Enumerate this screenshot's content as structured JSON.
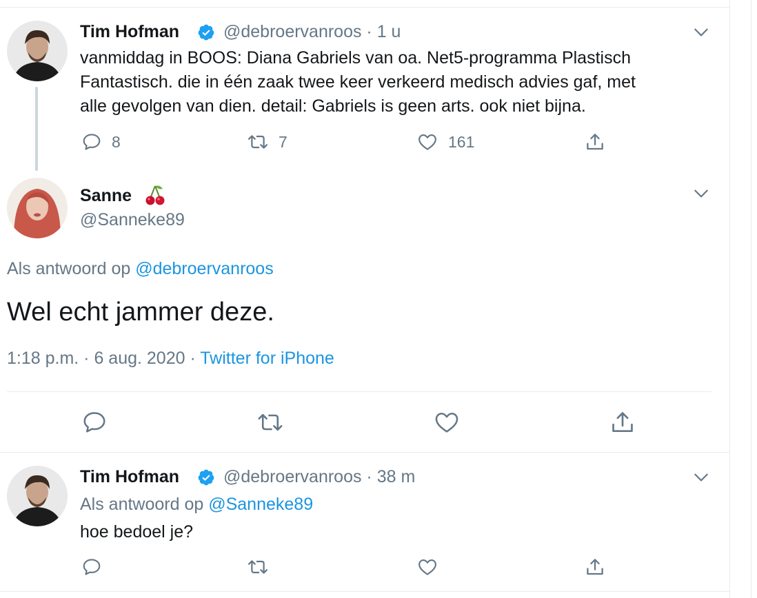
{
  "tweets": [
    {
      "name": "Tim Hofman",
      "handle": "@debroervanroos · 1 u",
      "lines": [
        "vanmiddag in BOOS: Diana Gabriels van oa. Net5-programma Plastisch",
        "Fantastisch. die in één zaak twee keer verkeerd medisch advies gaf, met",
        "alle gevolgen van dien. detail: Gabriels is geen arts. ook niet bijna."
      ],
      "replies": "8",
      "retweets": "7",
      "likes": "161"
    },
    {
      "name": "Sanne",
      "name_emoji": "🍒",
      "handle": "@Sanneke89",
      "reply_to_prefix": "Als antwoord op ",
      "reply_to_mention": "@debroervanroos",
      "text": "Wel echt jammer deze.",
      "time": "1:18 p.m. · 6 aug. 2020 · ",
      "source": "Twitter for iPhone"
    },
    {
      "name": "Tim Hofman",
      "handle": "@debroervanroos · 38 m",
      "reply_to_prefix": "Als antwoord op ",
      "reply_to_mention": "@Sanneke89",
      "text": "hoe bedoel je?"
    }
  ],
  "colors": {
    "text": "#14171a",
    "secondary": "#657786",
    "link": "#1b95e0",
    "verified": "#1da1f2",
    "border": "#e6ecf0"
  },
  "icons": [
    "reply-icon",
    "retweet-icon",
    "like-icon",
    "share-icon",
    "chevron-down-icon",
    "verified-badge-icon",
    "cherry-emoji"
  ]
}
